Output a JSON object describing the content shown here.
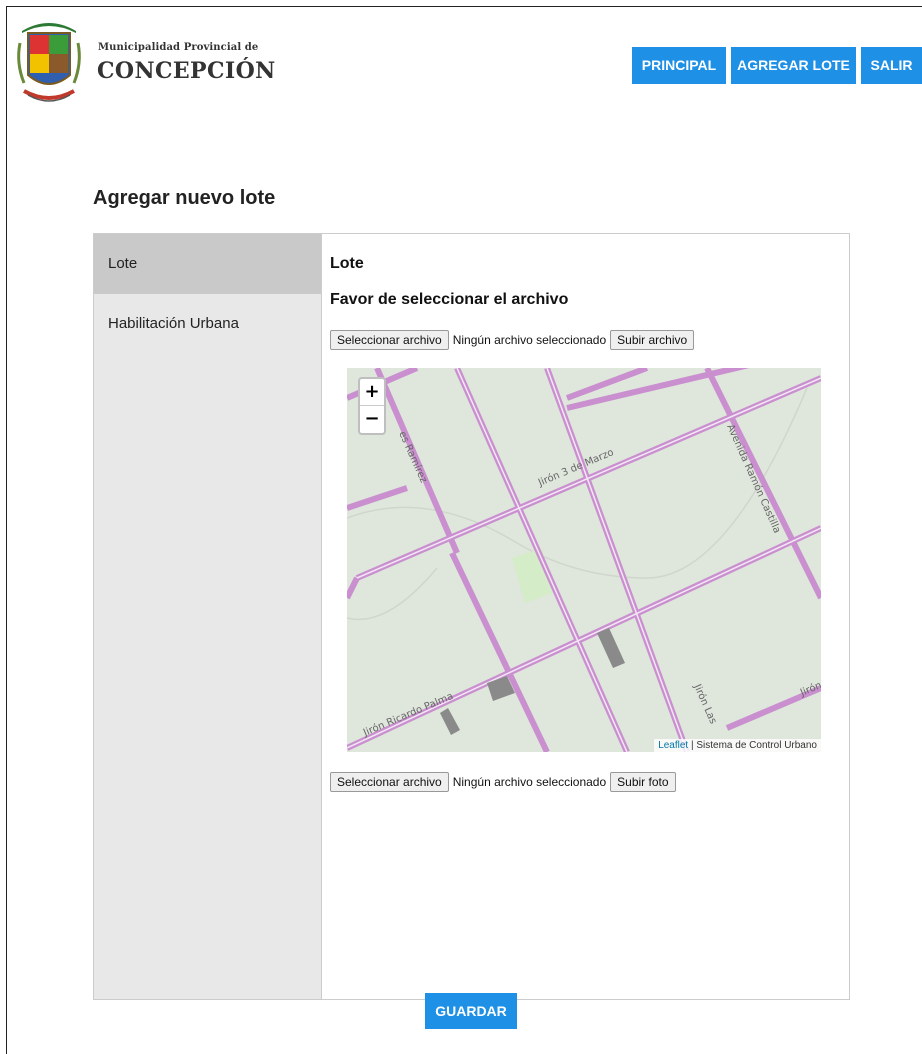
{
  "header": {
    "brand_small": "Municipalidad Provincial de",
    "brand_big": "CONCEPCIÓN",
    "nav": [
      {
        "label": "PRINCIPAL"
      },
      {
        "label": "AGREGAR LOTE"
      },
      {
        "label": "SALIR"
      }
    ]
  },
  "page": {
    "title": "Agregar nuevo lote"
  },
  "sidebar": {
    "items": [
      {
        "label": "Lote",
        "active": true
      },
      {
        "label": "Habilitación Urbana",
        "active": false
      }
    ]
  },
  "content": {
    "heading": "Lote",
    "subheading": "Favor de seleccionar el archivo",
    "file_row_1": {
      "choose": "Seleccionar archivo",
      "status": "Ningún archivo seleccionado",
      "upload": "Subir archivo"
    },
    "file_row_2": {
      "choose": "Seleccionar archivo",
      "status": "Ningún archivo seleccionado",
      "upload": "Subir foto"
    }
  },
  "map": {
    "zoom_in": "+",
    "zoom_out": "−",
    "street_labels": [
      "Jirón 3 de Marzo",
      "Avenida Ramón Castilla",
      "Jirón Ricardo Palma",
      "Jirón Las",
      "es Ramírez",
      "Jirón"
    ],
    "attribution_link": "Leaflet",
    "attribution_sep": " | ",
    "attribution_text": "Sistema de Control Urbano"
  },
  "actions": {
    "save": "GUARDAR"
  },
  "colors": {
    "accent": "#1e90e6",
    "road": "#c98fcf",
    "map_bg": "#dfe6dc"
  }
}
